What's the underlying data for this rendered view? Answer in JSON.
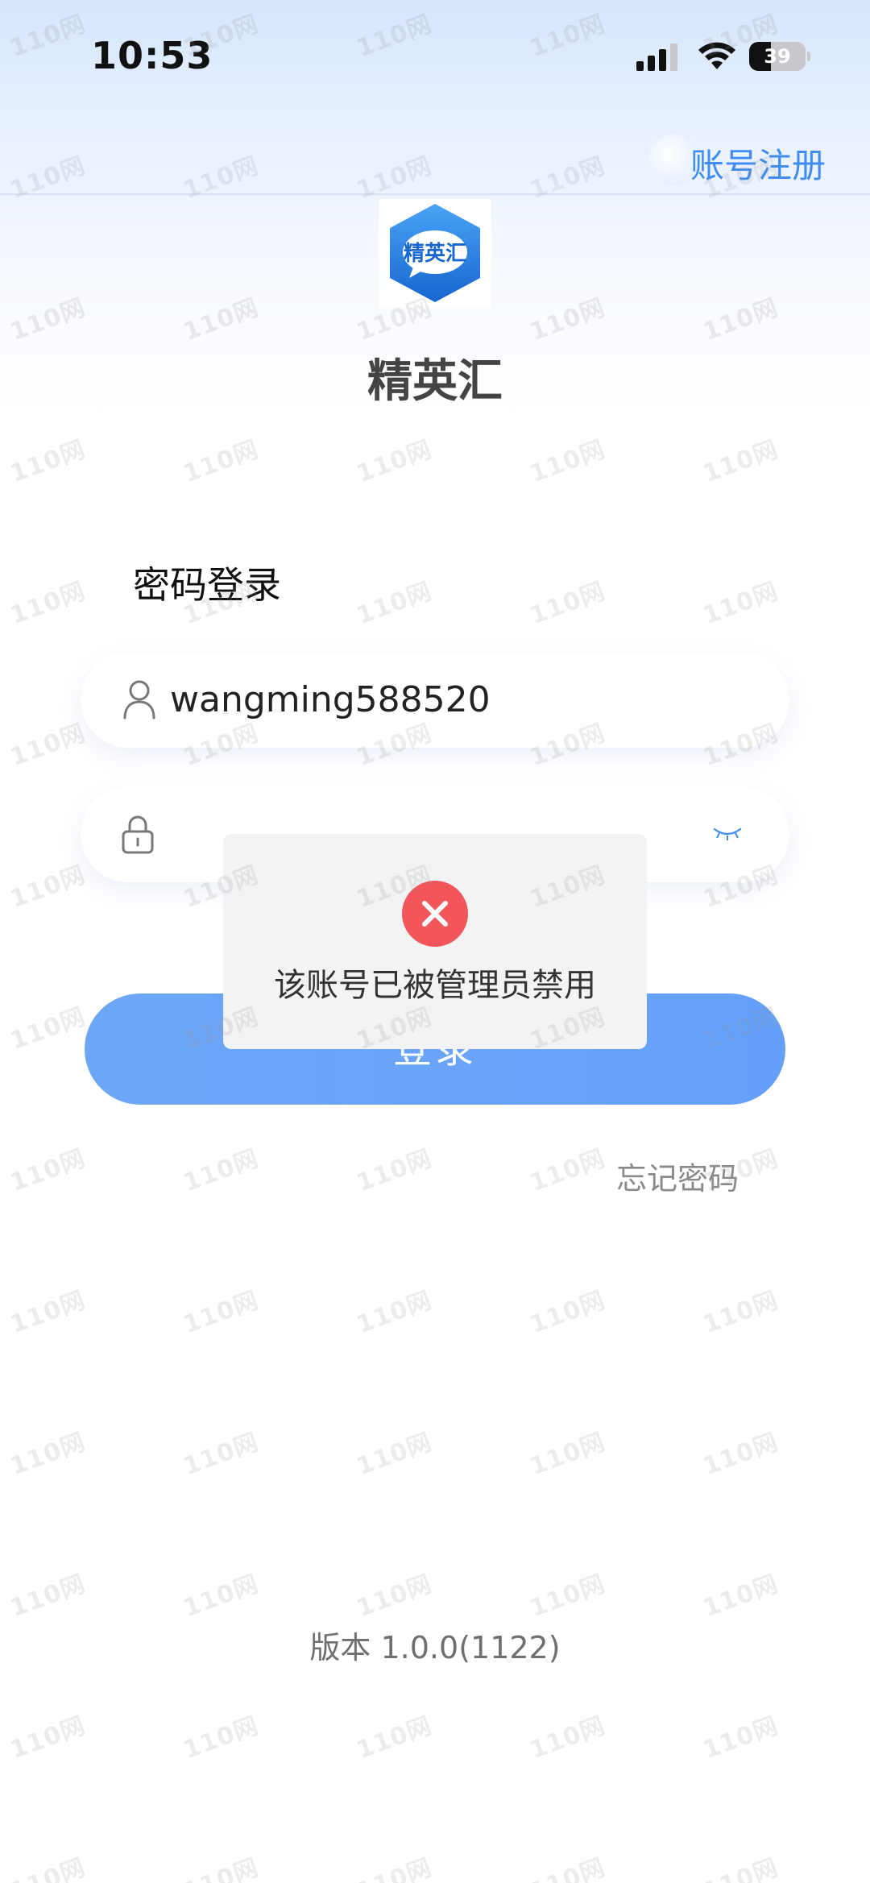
{
  "status_bar": {
    "time": "10:53",
    "battery": "39",
    "battery_level": 0.39
  },
  "header": {
    "register_link": "账号注册"
  },
  "app": {
    "logo_text": "精英汇",
    "name": "精英汇"
  },
  "login": {
    "title": "密码登录",
    "username_value": "wangming588520",
    "password_value": "",
    "submit_label": "登录",
    "forgot_password": "忘记密码"
  },
  "toast": {
    "message": "该账号已被管理员禁用"
  },
  "footer": {
    "version": "版本 1.0.0(1122)"
  },
  "watermark": "110网",
  "colors": {
    "accent": "#3e8cf2",
    "button": "#6aa4f8",
    "error": "#f2555a"
  }
}
